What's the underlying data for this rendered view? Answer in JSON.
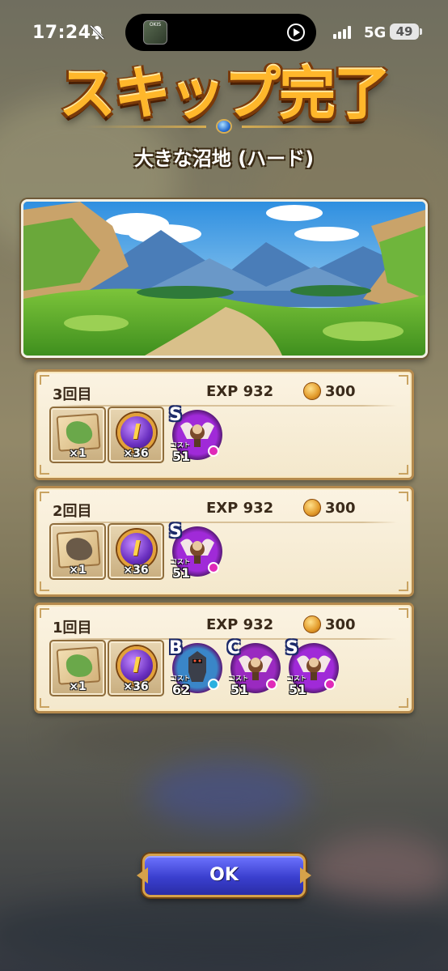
{
  "status_bar": {
    "time": "17:24",
    "network": "5G",
    "battery": "49",
    "island_app_label": "OKIS"
  },
  "screen": {
    "title": "スキップ完了",
    "stage_name": "大きな沼地 (ハード)"
  },
  "results": [
    {
      "round": "3回目",
      "exp": "EXP  932",
      "gold": "300",
      "items": [
        {
          "icon": "treasure-map-icon",
          "count": "×1"
        },
        {
          "icon": "orb-medal-icon",
          "count": "×36"
        }
      ],
      "monsters": [
        {
          "rank": "S",
          "cost_label": "コスト",
          "cost": "51",
          "icon": "winged-monster-icon",
          "color": "#a02ad8",
          "dot": "#e02ab8"
        }
      ]
    },
    {
      "round": "2回目",
      "exp": "EXP  932",
      "gold": "300",
      "items": [
        {
          "icon": "treasure-map-icon",
          "count": "×1"
        },
        {
          "icon": "orb-medal-icon",
          "count": "×36"
        }
      ],
      "monsters": [
        {
          "rank": "S",
          "cost_label": "コスト",
          "cost": "51",
          "icon": "winged-monster-icon",
          "color": "#a02ad8",
          "dot": "#e02ab8"
        }
      ]
    },
    {
      "round": "1回目",
      "exp": "EXP  932",
      "gold": "300",
      "items": [
        {
          "icon": "treasure-map-icon",
          "count": "×1"
        },
        {
          "icon": "orb-medal-icon",
          "count": "×36"
        }
      ],
      "monsters": [
        {
          "rank": "B",
          "cost_label": "コスト",
          "cost": "62",
          "icon": "armored-knight-icon",
          "color": "#3a86c8",
          "dot": "#2ab0e0"
        },
        {
          "rank": "C",
          "cost_label": "コスト",
          "cost": "51",
          "icon": "winged-monster-icon",
          "color": "#9a2ac0",
          "dot": "#e02ab8"
        },
        {
          "rank": "S",
          "cost_label": "コスト",
          "cost": "51",
          "icon": "winged-monster-icon",
          "color": "#a02ad8",
          "dot": "#e02ab8"
        }
      ]
    }
  ],
  "ok_button": {
    "label": "OK"
  },
  "colors": {
    "title": "#ffb72b",
    "panel_bg": "#fbf3e2",
    "panel_border": "#b58a4d",
    "ok_button": "#3a3fcf"
  }
}
